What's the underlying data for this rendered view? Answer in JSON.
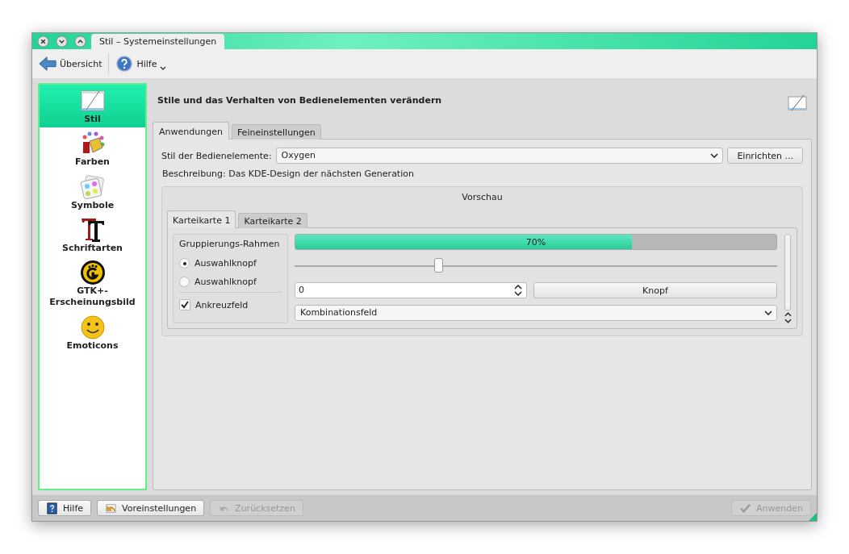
{
  "window": {
    "title": "Stil – Systemeinstellungen"
  },
  "toolbar": [
    {
      "kind": "back",
      "label": "Übersicht"
    },
    {
      "kind": "help",
      "label": "Hilfe",
      "menu": true
    }
  ],
  "sidebar": {
    "items": [
      {
        "kind": "style",
        "label": "Stil",
        "selected": true
      },
      {
        "kind": "colors",
        "label": "Farben",
        "selected": false
      },
      {
        "kind": "icons",
        "label": "Symbole",
        "selected": false
      },
      {
        "kind": "fonts",
        "label": "Schriftarten",
        "selected": false
      },
      {
        "kind": "gtk",
        "label": "GTK+-\nErscheinungsbild",
        "selected": false
      },
      {
        "kind": "emoticons",
        "label": "Emoticons",
        "selected": false
      }
    ]
  },
  "content": {
    "heading": "Stile und das Verhalten von Bedienelementen verändern",
    "tabs": [
      {
        "label": "Anwendungen",
        "selected": true
      },
      {
        "label": "Feineinstellungen",
        "selected": false
      }
    ],
    "style_label": "Stil der Bedienelemente:",
    "style_value": "Oxygen",
    "configure_button": "Einrichten ...",
    "description": "Beschreibung: Das KDE-Design der nächsten Generation",
    "preview": {
      "title": "Vorschau",
      "tabs": [
        {
          "label": "Karteikarte 1",
          "selected": true
        },
        {
          "label": "Karteikarte 2",
          "selected": false
        }
      ],
      "group_title": "Gruppierungs-Rahmen",
      "radios": [
        {
          "label": "Auswahlknopf",
          "selected": true
        },
        {
          "label": "Auswahlknopf",
          "selected": false
        }
      ],
      "checkbox": {
        "label": "Ankreuzfeld",
        "checked": true
      },
      "progress": {
        "level": 0.7,
        "text": "70%"
      },
      "slider": {
        "level": 0.3
      },
      "spinbox": "0",
      "button": "Knopf",
      "combo": "Kombinationsfeld"
    }
  },
  "footer": [
    {
      "kind": "help",
      "label": "Hilfe",
      "disabled": false
    },
    {
      "kind": "defaults",
      "label": "Voreinstellungen",
      "disabled": false
    },
    {
      "kind": "reset",
      "label": "Zurücksetzen",
      "disabled": true
    },
    {
      "kind": "apply",
      "label": "Anwenden",
      "disabled": true
    }
  ]
}
